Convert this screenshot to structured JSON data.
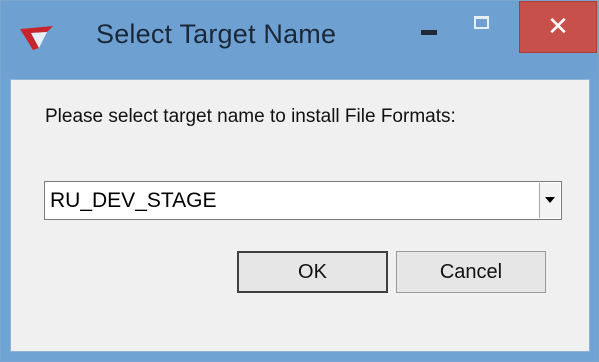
{
  "window": {
    "title": "Select Target Name",
    "icon": "app-logo-icon",
    "controls": {
      "minimize": "minimize-icon",
      "maximize": "maximize-icon",
      "close": "close-icon",
      "close_glyph": "✕"
    }
  },
  "dialog": {
    "prompt": "Please select target name to install File Formats:",
    "target_select": {
      "selected_value": "RU_DEV_STAGE",
      "arrow_icon": "chevron-down-icon"
    },
    "buttons": {
      "ok_label": "OK",
      "cancel_label": "Cancel"
    }
  },
  "colors": {
    "titlebar": "#6ea1d2",
    "close_button": "#c7504a",
    "client_background": "#f0f0f0"
  }
}
